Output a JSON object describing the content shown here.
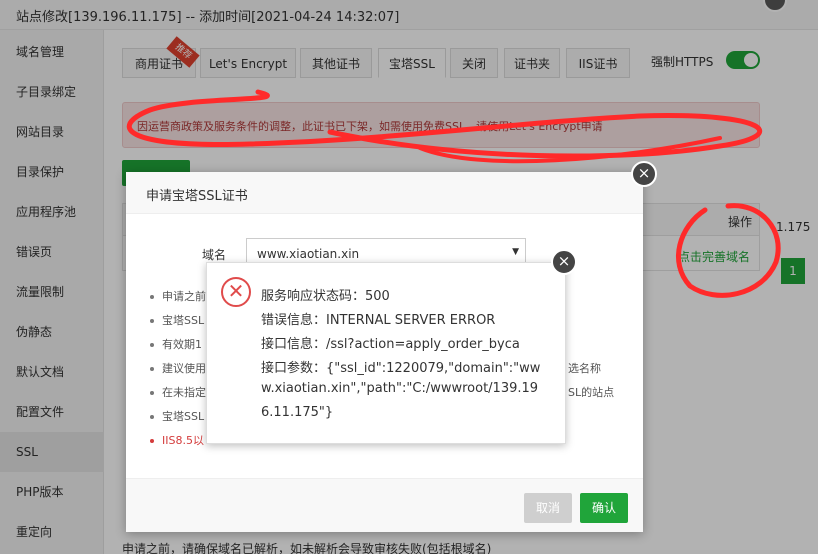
{
  "window": {
    "title": "站点修改[139.196.11.175] -- 添加时间[2021-04-24 14:32:07]"
  },
  "sidebar": {
    "items": [
      {
        "label": "域名管理"
      },
      {
        "label": "子目录绑定"
      },
      {
        "label": "网站目录"
      },
      {
        "label": "目录保护"
      },
      {
        "label": "应用程序池"
      },
      {
        "label": "错误页"
      },
      {
        "label": "流量限制"
      },
      {
        "label": "伪静态"
      },
      {
        "label": "默认文档"
      },
      {
        "label": "配置文件"
      },
      {
        "label": "SSL",
        "active": true
      },
      {
        "label": "PHP版本"
      },
      {
        "label": "重定向"
      }
    ]
  },
  "tabs": [
    {
      "label": "商用证书"
    },
    {
      "label": "Let's Encrypt"
    },
    {
      "label": "其他证书"
    },
    {
      "label": "宝塔SSL",
      "active": true
    },
    {
      "label": "关闭"
    },
    {
      "label": "证书夹"
    },
    {
      "label": "IIS证书"
    }
  ],
  "ribbon_label": "推荐",
  "force_https": {
    "label": "强制HTTPS",
    "enabled": true
  },
  "alert": {
    "text": "因运营商政策及服务条件的调整，此证书已下架，如需使用免费SSL，请使用Let's Encrypt申请"
  },
  "table": {
    "op_header": "操作",
    "row_action": "点击完善域名"
  },
  "background_fragments": {
    "side_number": "1.175",
    "page_number": "1",
    "bottom_note": "申请之前，请确保域名已解析，如未解析会导致审核失败(包括根域名)"
  },
  "dialog": {
    "title": "申请宝塔SSL证书",
    "domain_label": "域名",
    "domain_value": "www.xiaotian.xin",
    "notes": [
      {
        "text": "申请之前"
      },
      {
        "text": "宝塔SSL"
      },
      {
        "text": "有效期1"
      },
      {
        "text": "建议使用"
      },
      {
        "text": "在未指定"
      },
      {
        "text": "宝塔SSL"
      },
      {
        "text": "IIS8.5以",
        "red": true
      }
    ],
    "note_tails": {
      "row4": "选名称",
      "row5": "SL的站点"
    },
    "cancel_label": "取消",
    "confirm_label": "确认"
  },
  "error": {
    "lines": [
      "服务响应状态码：500",
      "错误信息：INTERNAL SERVER ERROR",
      "接口信息：/ssl?action=apply_order_byca",
      "接口参数：{\"ssl_id\":1220079,\"domain\":\"ww",
      "w.xiaotian.xin\",\"path\":\"C:/wwwroot/139.19",
      "6.11.175\"}"
    ]
  },
  "colors": {
    "accent_green": "#20a53a",
    "error_red": "#e04b4b",
    "scribble_red": "#ff2a2a"
  }
}
